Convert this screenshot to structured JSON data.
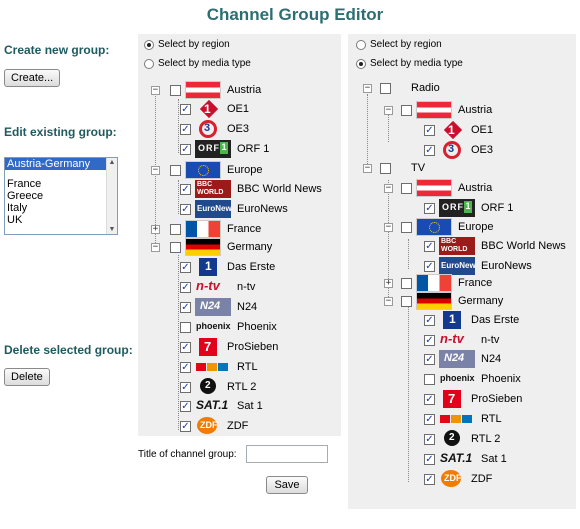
{
  "title": "Channel Group Editor",
  "sidebar": {
    "create_label": "Create new group:",
    "create_button": "Create...",
    "edit_label": "Edit existing group:",
    "groups": [
      "Austria-Germany",
      "France",
      "Greece",
      "Italy",
      "UK"
    ],
    "delete_label": "Delete selected group:",
    "delete_button": "Delete"
  },
  "left_panel": {
    "radio_region": "Select by region",
    "radio_media": "Select by media type",
    "selected_mode": "region",
    "tree": {
      "austria": {
        "label": "Austria",
        "channels": [
          "OE1",
          "OE3",
          "ORF 1"
        ]
      },
      "europe": {
        "label": "Europe",
        "channels": [
          "BBC World News",
          "EuroNews"
        ]
      },
      "france": {
        "label": "France"
      },
      "germany": {
        "label": "Germany",
        "channels": [
          "Das Erste",
          "n-tv",
          "N24",
          "Phoenix",
          "ProSieben",
          "RTL",
          "RTL 2",
          "Sat 1",
          "ZDF"
        ]
      }
    },
    "title_label": "Title of channel group:",
    "title_value": "",
    "save_button": "Save"
  },
  "right_panel": {
    "radio_region": "Select by region",
    "radio_media": "Select by media type",
    "selected_mode": "media",
    "tree": {
      "radio": "Radio",
      "radio_austria": "Austria",
      "radio_channels": [
        "OE1",
        "OE3"
      ],
      "tv": "TV",
      "tv_austria": "Austria",
      "tv_austria_channels": [
        "ORF 1"
      ],
      "tv_europe": "Europe",
      "tv_europe_channels": [
        "BBC World News",
        "EuroNews"
      ],
      "tv_france": "France",
      "tv_germany": "Germany",
      "tv_germany_channels": [
        "Das Erste",
        "n-tv",
        "N24",
        "Phoenix",
        "ProSieben",
        "RTL",
        "RTL 2",
        "Sat 1",
        "ZDF"
      ]
    }
  },
  "colors": {
    "heading": "#2d6e72",
    "panel_bg": "#efefef",
    "selection": "#3169c6"
  }
}
